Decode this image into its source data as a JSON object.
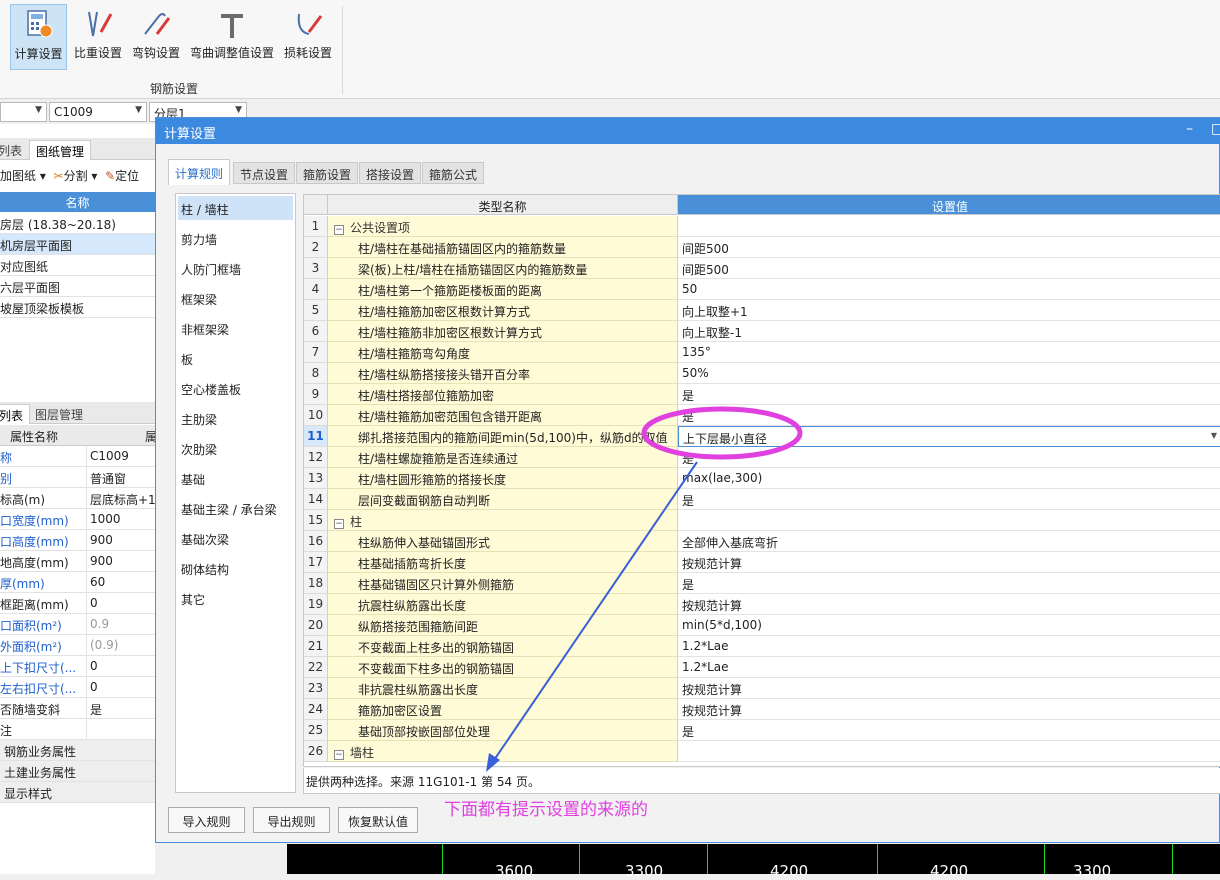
{
  "ribbon": {
    "buttons": [
      {
        "label": "计算设置",
        "icon": "calc-settings-icon"
      },
      {
        "label": "比重设置",
        "icon": "density-settings-icon"
      },
      {
        "label": "弯钩设置",
        "icon": "hook-settings-icon"
      },
      {
        "label": "弯曲调整值设置",
        "icon": "bend-adjust-icon"
      },
      {
        "label": "损耗设置",
        "icon": "loss-settings-icon"
      }
    ],
    "group_label": "钢筋设置"
  },
  "selectors": {
    "first": "",
    "second": "C1009",
    "third": "分层1"
  },
  "left_panel": {
    "tabs_top": [
      "列表",
      "图纸管理"
    ],
    "toolbar": {
      "add": "加图纸",
      "split": "分割",
      "locate": "定位"
    },
    "header": "名称",
    "drawings": [
      "房层 (18.38~20.18)",
      "机房层平面图",
      "对应图纸",
      "六层平面图",
      "坡屋顶梁板模板"
    ],
    "tabs_bottom": [
      "列表",
      "图层管理"
    ],
    "prop_header": {
      "name": "属性名称",
      "value": "属"
    },
    "props": [
      {
        "name": "称",
        "value": "C1009",
        "blue": true,
        "gray": false
      },
      {
        "name": "别",
        "value": "普通窗",
        "blue": true,
        "gray": false
      },
      {
        "name": "标高(m)",
        "value": "层底标高+1",
        "blue": false,
        "gray": false
      },
      {
        "name": "口宽度(mm)",
        "value": "1000",
        "blue": true,
        "gray": false
      },
      {
        "name": "口高度(mm)",
        "value": "900",
        "blue": true,
        "gray": false
      },
      {
        "name": "地高度(mm)",
        "value": "900",
        "blue": false,
        "gray": false
      },
      {
        "name": "厚(mm)",
        "value": "60",
        "blue": true,
        "gray": false
      },
      {
        "name": "框距离(mm)",
        "value": "0",
        "blue": false,
        "gray": false
      },
      {
        "name": "口面积(m²)",
        "value": "0.9",
        "blue": true,
        "gray": true
      },
      {
        "name": "外面积(m²)",
        "value": "(0.9)",
        "blue": true,
        "gray": true
      },
      {
        "name": "上下扣尺寸(...",
        "value": "0",
        "blue": true,
        "gray": false
      },
      {
        "name": "左右扣尺寸(...",
        "value": "0",
        "blue": true,
        "gray": false
      },
      {
        "name": "否随墙变斜",
        "value": "是",
        "blue": false,
        "gray": false
      },
      {
        "name": "注",
        "value": "",
        "blue": false,
        "gray": false
      },
      {
        "name": "钢筋业务属性",
        "value": "",
        "blue": false,
        "gray": false,
        "group": true
      },
      {
        "name": "土建业务属性",
        "value": "",
        "blue": false,
        "gray": false,
        "group": true
      },
      {
        "name": "显示样式",
        "value": "",
        "blue": false,
        "gray": false,
        "group": true
      }
    ]
  },
  "canvas": {
    "numbers": [
      "3600",
      "3300",
      "4200",
      "4200",
      "3300"
    ]
  },
  "dialog": {
    "title": "计算设置",
    "controls": {
      "minimize": "–",
      "maximize": "□"
    },
    "tabs": [
      "计算规则",
      "节点设置",
      "箍筋设置",
      "搭接设置",
      "箍筋公式"
    ],
    "categories": [
      "柱 / 墙柱",
      "剪力墙",
      "人防门框墙",
      "框架梁",
      "非框架梁",
      "板",
      "空心楼盖板",
      "主肋梁",
      "次肋梁",
      "基础",
      "基础主梁 / 承台梁",
      "基础次梁",
      "砌体结构",
      "其它"
    ],
    "grid": {
      "col_name": "类型名称",
      "col_value": "设置值",
      "rows": [
        {
          "no": "1",
          "name": "公共设置项",
          "value": "",
          "group": true
        },
        {
          "no": "2",
          "name": "柱/墙柱在基础插筋锚固区内的箍筋数量",
          "value": "间距500"
        },
        {
          "no": "3",
          "name": "梁(板)上柱/墙柱在插筋锚固区内的箍筋数量",
          "value": "间距500"
        },
        {
          "no": "4",
          "name": "柱/墙柱第一个箍筋距楼板面的距离",
          "value": "50"
        },
        {
          "no": "5",
          "name": "柱/墙柱箍筋加密区根数计算方式",
          "value": "向上取整+1"
        },
        {
          "no": "6",
          "name": "柱/墙柱箍筋非加密区根数计算方式",
          "value": "向上取整-1"
        },
        {
          "no": "7",
          "name": "柱/墙柱箍筋弯勾角度",
          "value": "135°"
        },
        {
          "no": "8",
          "name": "柱/墙柱纵筋搭接接头错开百分率",
          "value": "50%"
        },
        {
          "no": "9",
          "name": "柱/墙柱搭接部位箍筋加密",
          "value": "是"
        },
        {
          "no": "10",
          "name": "柱/墙柱箍筋加密范围包含错开距离",
          "value": "是"
        },
        {
          "no": "11",
          "name": "绑扎搭接范围内的箍筋间距min(5d,100)中，纵筋d的取值",
          "value": "上下层最小直径",
          "selected": true
        },
        {
          "no": "12",
          "name": "柱/墙柱螺旋箍筋是否连续通过",
          "value": "是"
        },
        {
          "no": "13",
          "name": "柱/墙柱圆形箍筋的搭接长度",
          "value": "max(lae,300)"
        },
        {
          "no": "14",
          "name": "层间变截面钢筋自动判断",
          "value": "是"
        },
        {
          "no": "15",
          "name": "柱",
          "value": "",
          "group": true
        },
        {
          "no": "16",
          "name": "柱纵筋伸入基础锚固形式",
          "value": "全部伸入基底弯折"
        },
        {
          "no": "17",
          "name": "柱基础插筋弯折长度",
          "value": "按规范计算"
        },
        {
          "no": "18",
          "name": "柱基础锚固区只计算外侧箍筋",
          "value": "是"
        },
        {
          "no": "19",
          "name": "抗震柱纵筋露出长度",
          "value": "按规范计算"
        },
        {
          "no": "20",
          "name": "纵筋搭接范围箍筋间距",
          "value": "min(5*d,100)"
        },
        {
          "no": "21",
          "name": "不变截面上柱多出的钢筋锚固",
          "value": "1.2*Lae"
        },
        {
          "no": "22",
          "name": "不变截面下柱多出的钢筋锚固",
          "value": "1.2*Lae"
        },
        {
          "no": "23",
          "name": "非抗震柱纵筋露出长度",
          "value": "按规范计算"
        },
        {
          "no": "24",
          "name": "箍筋加密区设置",
          "value": "按规范计算"
        },
        {
          "no": "25",
          "name": "基础顶部按嵌固部位处理",
          "value": "是"
        },
        {
          "no": "26",
          "name": "墙柱",
          "value": "",
          "group": true
        }
      ]
    },
    "hint": "提供两种选择。来源 11G101-1 第 54 页。",
    "buttons": [
      "导入规则",
      "导出规则",
      "恢复默认值"
    ]
  },
  "annotation": {
    "text": "下面都有提示设置的来源的",
    "color": "#e040e0",
    "arrow_color": "#3a5fd6"
  }
}
